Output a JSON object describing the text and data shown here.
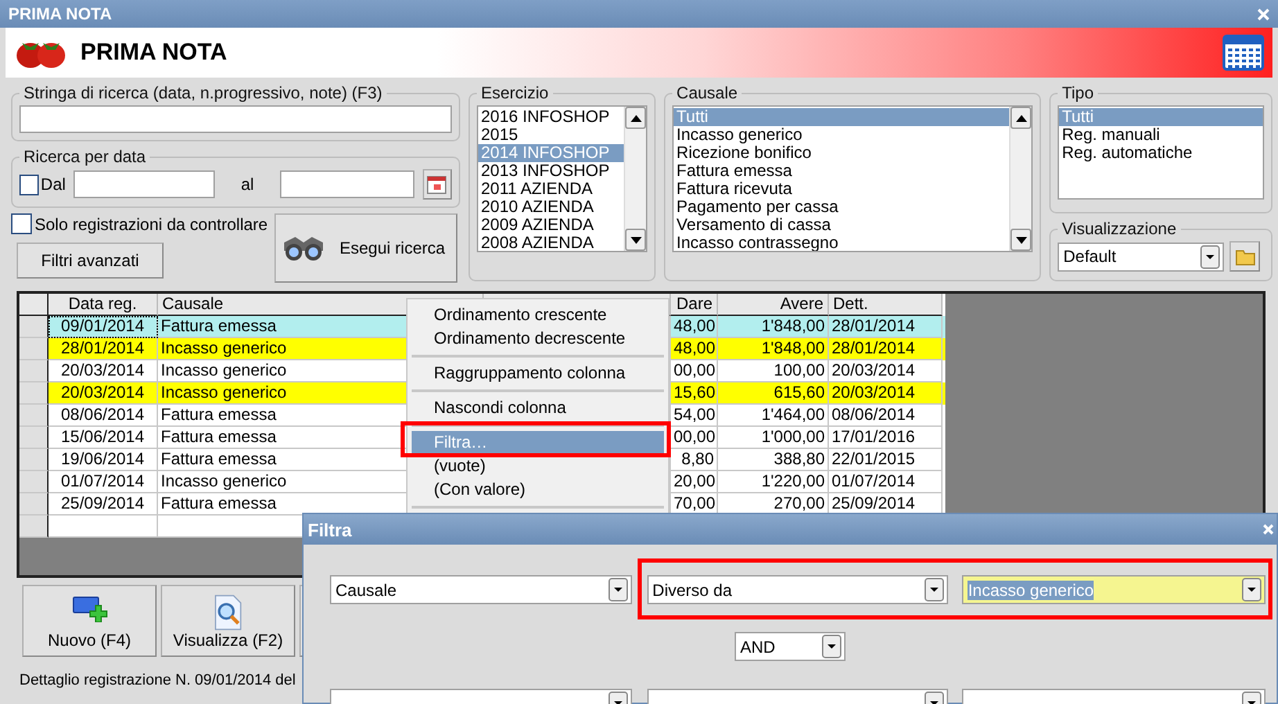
{
  "window": {
    "title": "PRIMA NOTA"
  },
  "header": {
    "title": "PRIMA NOTA"
  },
  "search": {
    "label": "Stringa di ricerca (data, n.progressivo, note) (F3)"
  },
  "date_search": {
    "label": "Ricerca per data",
    "from_label": "Dal",
    "from_checked": false,
    "to_label": "al"
  },
  "only_to_check": {
    "label": "Solo registrazioni da controllare",
    "checked": false
  },
  "advanced_button": "Filtri avanzati",
  "run_button": "Esegui ricerca",
  "esercizio": {
    "label": "Esercizio",
    "items": [
      {
        "label": "2016 INFOSHOP",
        "selected": false
      },
      {
        "label": "2015",
        "selected": false
      },
      {
        "label": "2014 INFOSHOP",
        "selected": true
      },
      {
        "label": "2013 INFOSHOP",
        "selected": false
      },
      {
        "label": "2011 AZIENDA",
        "selected": false
      },
      {
        "label": "2010 AZIENDA",
        "selected": false
      },
      {
        "label": "2009 AZIENDA",
        "selected": false
      },
      {
        "label": "2008 AZIENDA",
        "selected": false
      }
    ]
  },
  "causale": {
    "label": "Causale",
    "items": [
      {
        "label": "Tutti",
        "selected": true
      },
      {
        "label": "Incasso generico",
        "selected": false
      },
      {
        "label": "Ricezione bonifico",
        "selected": false
      },
      {
        "label": "Fattura emessa",
        "selected": false
      },
      {
        "label": "Fattura ricevuta",
        "selected": false
      },
      {
        "label": "Pagamento per cassa",
        "selected": false
      },
      {
        "label": "Versamento di cassa",
        "selected": false
      },
      {
        "label": "Incasso contrassegno",
        "selected": false
      }
    ]
  },
  "tipo": {
    "label": "Tipo",
    "items": [
      {
        "label": "Tutti",
        "selected": true
      },
      {
        "label": "Reg. manuali",
        "selected": false
      },
      {
        "label": "Reg. automatiche",
        "selected": false
      }
    ]
  },
  "visualizzazione": {
    "label": "Visualizzazione",
    "value": "Default"
  },
  "table": {
    "columns": [
      "Data reg.",
      "Causale",
      "",
      "Dare",
      "Avere",
      "Dett."
    ],
    "rows": [
      {
        "cells": [
          "09/01/2014",
          "Fattura emessa",
          "",
          "48,00",
          "1'848,00",
          "28/01/2014"
        ],
        "color": "#b2eeee",
        "selected": true
      },
      {
        "cells": [
          "28/01/2014",
          "Incasso generico",
          "",
          "48,00",
          "1'848,00",
          "28/01/2014"
        ],
        "color": "#ffff00",
        "selected": false
      },
      {
        "cells": [
          "20/03/2014",
          "Incasso generico",
          "",
          "00,00",
          "100,00",
          "20/03/2014"
        ],
        "color": "#ffffff",
        "selected": false
      },
      {
        "cells": [
          "20/03/2014",
          "Incasso generico",
          "",
          "15,60",
          "615,60",
          "20/03/2014"
        ],
        "color": "#ffff00",
        "selected": false
      },
      {
        "cells": [
          "08/06/2014",
          "Fattura emessa",
          "",
          "54,00",
          "1'464,00",
          "08/06/2014"
        ],
        "color": "#ffffff",
        "selected": false
      },
      {
        "cells": [
          "15/06/2014",
          "Fattura emessa",
          "",
          "00,00",
          "1'000,00",
          "17/01/2016"
        ],
        "color": "#ffffff",
        "selected": false
      },
      {
        "cells": [
          "19/06/2014",
          "Fattura emessa",
          "",
          "8,80",
          "388,80",
          "22/01/2015"
        ],
        "color": "#ffffff",
        "selected": false
      },
      {
        "cells": [
          "01/07/2014",
          "Incasso generico",
          "",
          "20,00",
          "1'220,00",
          "01/07/2014"
        ],
        "color": "#ffffff",
        "selected": false
      },
      {
        "cells": [
          "25/09/2014",
          "Fattura emessa",
          "",
          "70,00",
          "270,00",
          "25/09/2014"
        ],
        "color": "#ffffff",
        "selected": false
      }
    ]
  },
  "actions": [
    {
      "label": "Nuovo (F4)",
      "kind": "new"
    },
    {
      "label": "Visualizza (F2)",
      "kind": "view"
    }
  ],
  "detail": {
    "label": "Dettaglio registrazione N. 09/01/2014 del"
  },
  "context_menu": {
    "items": [
      {
        "kind": "item",
        "label": "Ordinamento crescente",
        "selected": false
      },
      {
        "kind": "item",
        "label": "Ordinamento decrescente",
        "selected": false
      },
      {
        "kind": "separator"
      },
      {
        "kind": "item",
        "label": "Raggruppamento colonna",
        "selected": false
      },
      {
        "kind": "separator"
      },
      {
        "kind": "item",
        "label": "Nascondi colonna",
        "selected": false
      },
      {
        "kind": "separator"
      },
      {
        "kind": "item",
        "label": "Filtra…",
        "selected": true
      },
      {
        "kind": "item",
        "label": "(vuote)",
        "selected": false
      },
      {
        "kind": "item",
        "label": "(Con valore)",
        "selected": false
      },
      {
        "kind": "separator"
      }
    ]
  },
  "filter_dialog": {
    "title": "Filtra",
    "field": "Causale",
    "operator": "Diverso da",
    "value": "Incasso generico",
    "joiner": "AND"
  }
}
